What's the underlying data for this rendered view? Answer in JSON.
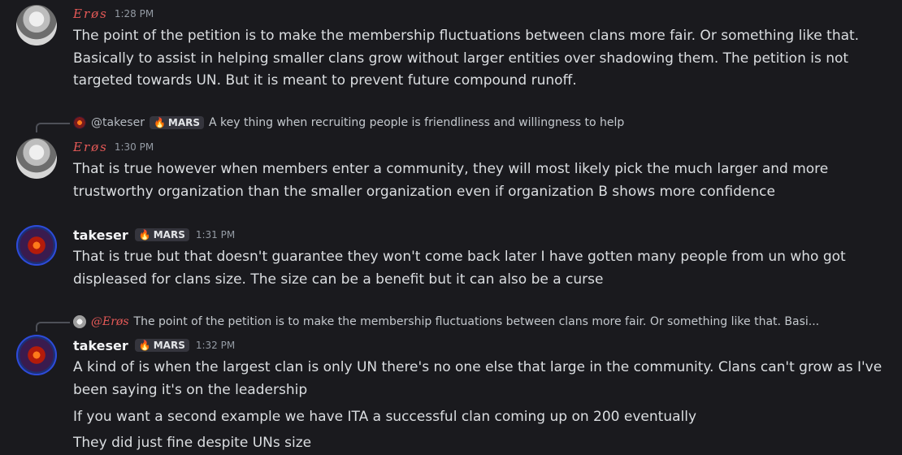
{
  "messages": [
    {
      "author": "Erøs",
      "time": "1:28 PM",
      "lines": [
        "The point of the petition is to make the membership fluctuations between clans more fair. Or something like that.",
        "Basically to assist in helping smaller clans grow without larger entities over shadowing them. The petition is not",
        "targeted towards UN. But it is meant to prevent future compound runoff."
      ]
    },
    {
      "reply": {
        "mention": "@takeser",
        "tag": "MARS",
        "text": "A key thing when recruiting people is friendliness and willingness to help"
      },
      "author": "Erøs",
      "time": "1:30 PM",
      "lines": [
        "That is true however when members enter a community, they will most likely pick the much larger and more",
        "trustworthy organization than the smaller organization even if organization B shows more confidence"
      ]
    },
    {
      "author": "takeser",
      "tag": "MARS",
      "time": "1:31 PM",
      "lines": [
        "That is true but that doesn't guarantee they won't come back later I have gotten many people from un who got",
        "displeased for clans size. The size can be a benefit but it can also be a curse"
      ]
    },
    {
      "reply": {
        "mention": "@Erøs",
        "text": "The point of the petition is to make the membership fluctuations between clans more fair. Or something like that. Basi..."
      },
      "author": "takeser",
      "tag": "MARS",
      "time": "1:32 PM",
      "lines": [
        "A kind of is when the largest clan is only UN there's no one else that large in the community. Clans can't grow as I've",
        "been saying it's on the leadership"
      ],
      "followups": [
        "If you want a second example we have ITA a successful clan coming up on 200 eventually",
        "They did just fine despite UNs  size"
      ]
    }
  ],
  "icons": {
    "tag_icon": "fire-icon"
  },
  "colors": {
    "background": "#1a1a1e",
    "eros_name": "#e85a58",
    "takeser_name": "#f2f3f5",
    "text": "#dbdee1",
    "timestamp": "#949ba4",
    "tag_bg": "#35353d"
  }
}
